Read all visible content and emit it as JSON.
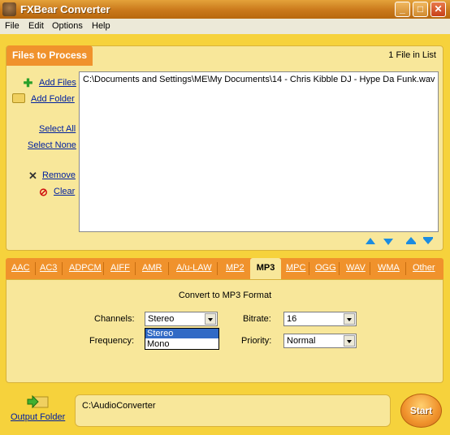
{
  "window": {
    "title": "FXBear Converter",
    "min_label": "_",
    "max_label": "□",
    "close_label": "✕"
  },
  "menu": [
    "File",
    "Edit",
    "Options",
    "Help"
  ],
  "files": {
    "tab_label": "Files to Process",
    "count": "1 File in List",
    "add_files": "Add Files",
    "add_folder": "Add Folder",
    "select_all": "Select All",
    "select_none": "Select None",
    "remove": "Remove",
    "clear": "Clear",
    "list": [
      "C:\\Documents and Settings\\ME\\My Documents\\14 - Chris Kibble DJ - Hype Da Funk.wav"
    ]
  },
  "formats": {
    "items": [
      "AAC",
      "AC3",
      "ADPCM",
      "AIFF",
      "AMR",
      "A/u-LAW",
      "MP2",
      "MP3",
      "MPC",
      "OGG",
      "WAV",
      "WMA",
      "Other"
    ],
    "active": "MP3"
  },
  "settings": {
    "title": "Convert to MP3 Format",
    "channels_label": "Channels:",
    "channels_value": "Stereo",
    "channels_options": [
      "Stereo",
      "Mono"
    ],
    "frequency_label": "Frequency:",
    "bitrate_label": "Bitrate:",
    "bitrate_value": "16",
    "priority_label": "Priority:",
    "priority_value": "Normal"
  },
  "output": {
    "folder_label": "Output Folder",
    "path": "C:\\AudioConverter",
    "start_label": "Start"
  },
  "colors": {
    "accent": "#f0922c",
    "panel": "#f8e79a",
    "background": "#f6d23c",
    "link": "#0020a0"
  }
}
